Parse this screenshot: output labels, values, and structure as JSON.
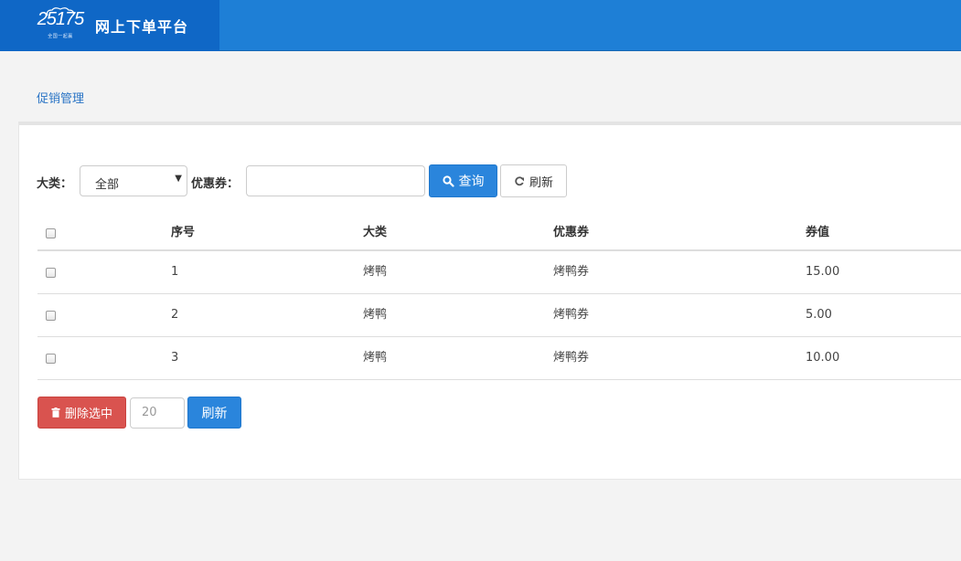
{
  "header": {
    "logo_text": "25175",
    "logo_sub": "全国一起赢",
    "title": "网上下单平台",
    "brand_color": "#0f67c6",
    "bar_color": "#1e7fd6"
  },
  "breadcrumb": {
    "current": "促销管理"
  },
  "filters": {
    "category_label": "大类：",
    "category_value": "全部",
    "coupon_label": "优惠券：",
    "coupon_value": "",
    "search_label": "查询",
    "refresh_label": "刷新"
  },
  "table": {
    "columns": [
      "序号",
      "大类",
      "优惠券",
      "券值"
    ],
    "rows": [
      {
        "index": "1",
        "category": "烤鸭",
        "coupon": "烤鸭券",
        "value": "15.00"
      },
      {
        "index": "2",
        "category": "烤鸭",
        "coupon": "烤鸭券",
        "value": "5.00"
      },
      {
        "index": "3",
        "category": "烤鸭",
        "coupon": "烤鸭券",
        "value": "10.00"
      }
    ]
  },
  "footer": {
    "delete_label": "删除选中",
    "page_size": "20",
    "refresh_label": "刷新"
  },
  "icons": {
    "search": "search-icon",
    "refresh": "refresh-icon",
    "delete": "trash-icon",
    "caret": "caret-down-icon",
    "logo": "cloud-logo-icon"
  }
}
